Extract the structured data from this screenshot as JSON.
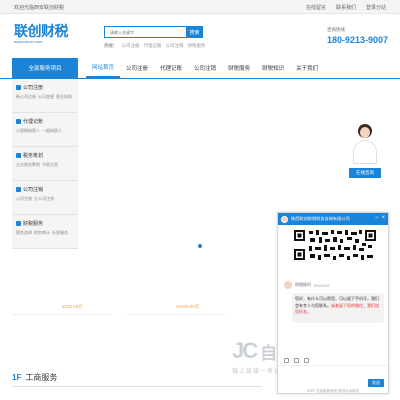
{
  "topbar": {
    "welcome": "欢迎光临西安联创财税",
    "links": [
      "在线留言",
      "联系我们",
      "登录分站"
    ]
  },
  "logo": {
    "main": "联创财税",
    "sub": "www.lxicoo.com"
  },
  "search": {
    "placeholder": "请输入关键字",
    "button": "搜索",
    "hot_label": "热搜：",
    "hot_items": [
      "公司注册",
      "代理记账",
      "公司注销",
      "财税服务"
    ]
  },
  "hotline": {
    "label": "咨询热线",
    "number": "180-9213-9007"
  },
  "nav": {
    "all_label": "全部服务项目",
    "items": [
      "网站首页",
      "公司注册",
      "代理记账",
      "公司注销",
      "财税服务",
      "财税知识",
      "关于我们"
    ],
    "active_index": 0
  },
  "sidebar": {
    "categories": [
      {
        "title": "公司注册",
        "subs": [
          "新公司注册",
          "公司变更",
          "营业执照"
        ]
      },
      {
        "title": "代理记账",
        "subs": [
          "小规模纳税人",
          "一般纳税人"
        ]
      },
      {
        "title": "税务筹划",
        "subs": [
          "企业税务筹划",
          "节税方案"
        ]
      },
      {
        "title": "公司注销",
        "subs": [
          "公司注销",
          "分公司注销"
        ]
      },
      {
        "title": "财税服务",
        "subs": [
          "税务咨询",
          "财务审计",
          "社保服务"
        ]
      }
    ]
  },
  "service": {
    "button": "在线咨询"
  },
  "prices": [
    "¥200.00元",
    "¥1200.00元"
  ],
  "section": {
    "num": "1F",
    "title": "工商服务"
  },
  "watermark": {
    "main": "自动秒收录",
    "sub": "做上链接一来访一次一自动收录"
  },
  "chat": {
    "title": "陕西联创财税财务咨询有限公司",
    "agent": "财税顾问",
    "time": "09:09:02",
    "message_parts": [
      "您好，有什么可以帮您，可以留下手机号，我们会有专人与您联系。",
      "或者留下您的微信，我们加您好友。"
    ],
    "send": "发送",
    "footer": "53KF 在线客服系统 提供技术服务"
  },
  "colors": {
    "accent": "#1a84d8",
    "price": "#f0a050",
    "highlight": "#e33333"
  }
}
